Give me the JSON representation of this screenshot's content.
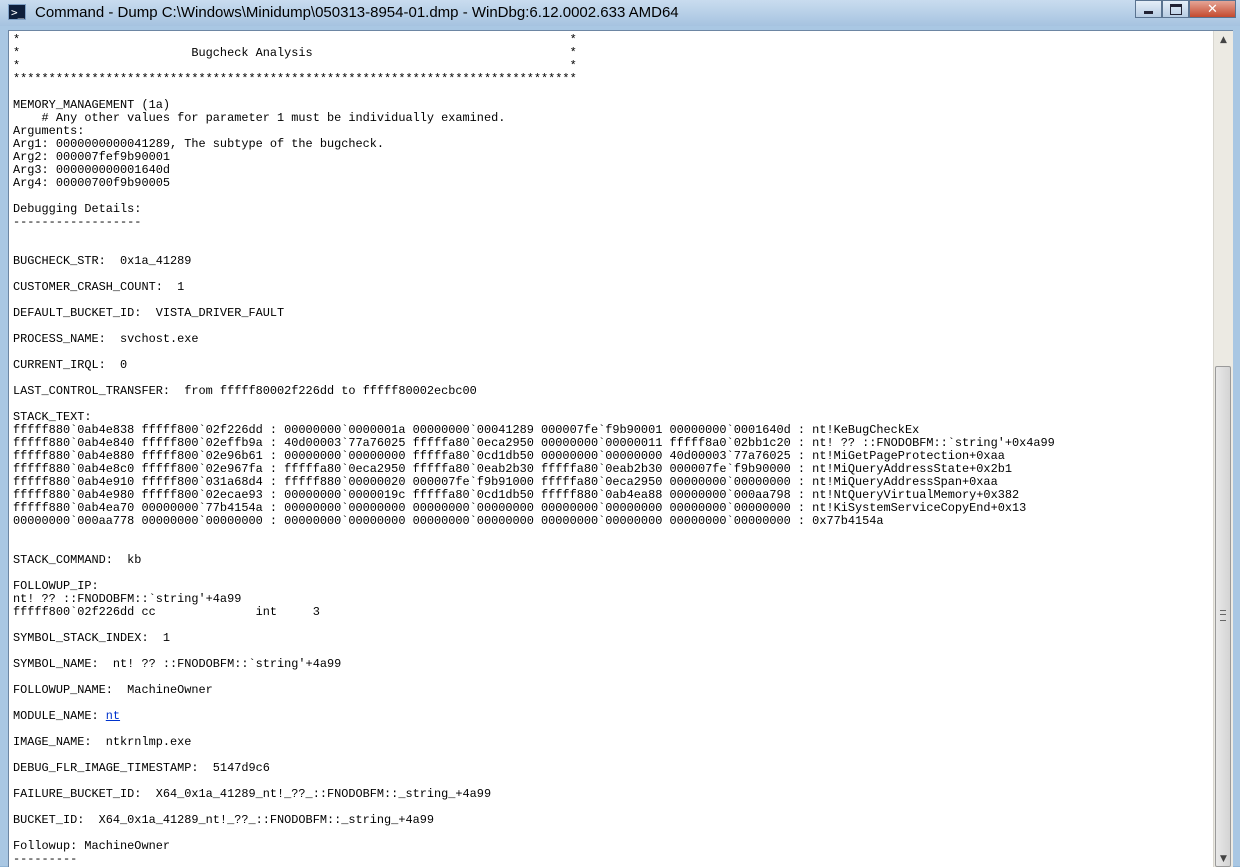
{
  "window": {
    "title": "Command - Dump C:\\Windows\\Minidump\\050313-8954-01.dmp - WinDbg:6.12.0002.633 AMD64",
    "app_icon_glyph": ">_",
    "minimize_label": "",
    "maximize_label": "",
    "close_label": "✕"
  },
  "scrollbar": {
    "up_arrow": "▲",
    "down_arrow": "▼",
    "position_fraction": 0.4
  },
  "output": {
    "before_link": "*                                                                             *\n*                        Bugcheck Analysis                                    *\n*                                                                             *\n*******************************************************************************\n\nMEMORY_MANAGEMENT (1a)\n    # Any other values for parameter 1 must be individually examined.\nArguments:\nArg1: 0000000000041289, The subtype of the bugcheck.\nArg2: 000007fef9b90001\nArg3: 000000000001640d\nArg4: 00000700f9b90005\n\nDebugging Details:\n------------------\n\n\nBUGCHECK_STR:  0x1a_41289\n\nCUSTOMER_CRASH_COUNT:  1\n\nDEFAULT_BUCKET_ID:  VISTA_DRIVER_FAULT\n\nPROCESS_NAME:  svchost.exe\n\nCURRENT_IRQL:  0\n\nLAST_CONTROL_TRANSFER:  from fffff80002f226dd to fffff80002ecbc00\n\nSTACK_TEXT:\nfffff880`0ab4e838 fffff800`02f226dd : 00000000`0000001a 00000000`00041289 000007fe`f9b90001 00000000`0001640d : nt!KeBugCheckEx\nfffff880`0ab4e840 fffff800`02effb9a : 40d00003`77a76025 fffffa80`0eca2950 00000000`00000011 fffff8a0`02bb1c20 : nt! ?? ::FNODOBFM::`string'+0x4a99\nfffff880`0ab4e880 fffff800`02e96b61 : 00000000`00000000 fffffa80`0cd1db50 00000000`00000000 40d00003`77a76025 : nt!MiGetPageProtection+0xaa\nfffff880`0ab4e8c0 fffff800`02e967fa : fffffa80`0eca2950 fffffa80`0eab2b30 fffffa80`0eab2b30 000007fe`f9b90000 : nt!MiQueryAddressState+0x2b1\nfffff880`0ab4e910 fffff800`031a68d4 : fffff880`00000020 000007fe`f9b91000 fffffa80`0eca2950 00000000`00000000 : nt!MiQueryAddressSpan+0xaa\nfffff880`0ab4e980 fffff800`02ecae93 : 00000000`0000019c fffffa80`0cd1db50 fffff880`0ab4ea88 00000000`000aa798 : nt!NtQueryVirtualMemory+0x382\nfffff880`0ab4ea70 00000000`77b4154a : 00000000`00000000 00000000`00000000 00000000`00000000 00000000`00000000 : nt!KiSystemServiceCopyEnd+0x13\n00000000`000aa778 00000000`00000000 : 00000000`00000000 00000000`00000000 00000000`00000000 00000000`00000000 : 0x77b4154a\n\n\nSTACK_COMMAND:  kb\n\nFOLLOWUP_IP:\nnt! ?? ::FNODOBFM::`string'+4a99\nfffff800`02f226dd cc              int     3\n\nSYMBOL_STACK_INDEX:  1\n\nSYMBOL_NAME:  nt! ?? ::FNODOBFM::`string'+4a99\n\nFOLLOWUP_NAME:  MachineOwner\n\nMODULE_NAME: ",
    "module_link": "nt",
    "after_link": "\n\nIMAGE_NAME:  ntkrnlmp.exe\n\nDEBUG_FLR_IMAGE_TIMESTAMP:  5147d9c6\n\nFAILURE_BUCKET_ID:  X64_0x1a_41289_nt!_??_::FNODOBFM::_string_+4a99\n\nBUCKET_ID:  X64_0x1a_41289_nt!_??_::FNODOBFM::_string_+4a99\n\nFollowup: MachineOwner\n---------"
  }
}
